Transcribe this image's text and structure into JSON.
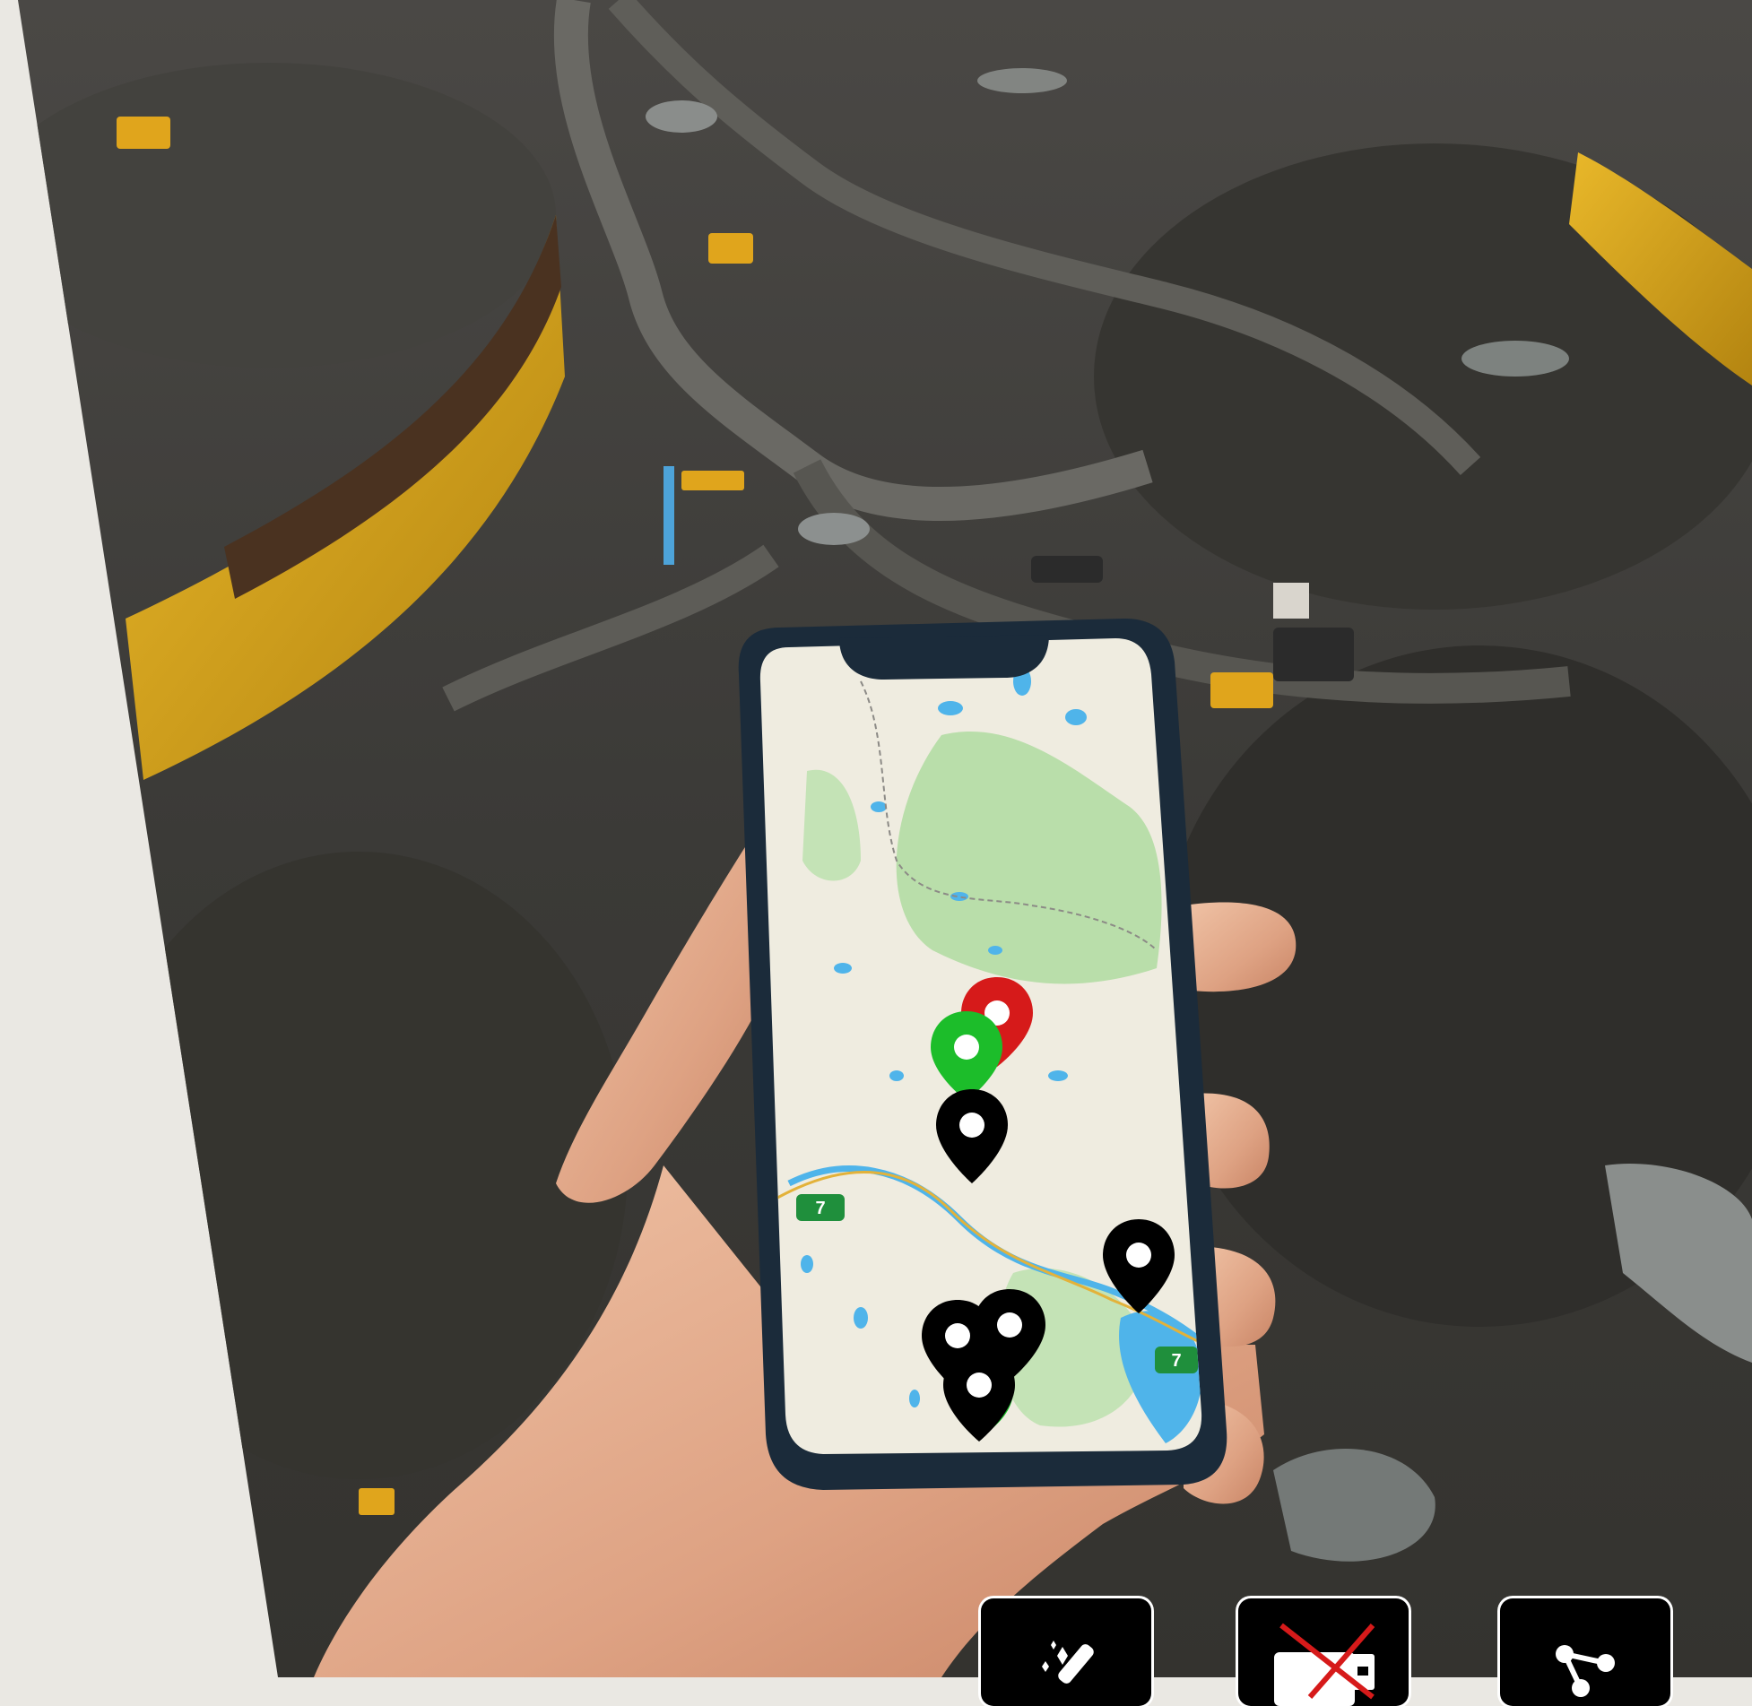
{
  "scene": {
    "description_icons": [
      "magic-wand-icon",
      "no-email-icon",
      "share-icon"
    ],
    "colors": {
      "side_panel": "#eae8e3",
      "ground": "#3d3c39",
      "barrier_yellow": "#d9a520",
      "phone_frame": "#1b2b3a",
      "pin_black": "#000000",
      "pin_green": "#1cbd2a",
      "pin_red": "#d61a1a",
      "road_badge": "#1f8f3c",
      "map_forest": "#b9deaa",
      "map_water": "#4fb4ea",
      "map_land": "#efece0"
    }
  },
  "map": {
    "road_badges": [
      "7",
      "7"
    ],
    "pins": [
      {
        "color": "red"
      },
      {
        "color": "green"
      },
      {
        "color": "black"
      },
      {
        "color": "black"
      },
      {
        "color": "black"
      },
      {
        "color": "black"
      },
      {
        "color": "black"
      },
      {
        "color": "green"
      }
    ]
  },
  "toolbar": {
    "buttons": [
      {
        "icon": "magic-wand-icon"
      },
      {
        "icon": "no-email-icon"
      },
      {
        "icon": "share-icon"
      }
    ]
  }
}
